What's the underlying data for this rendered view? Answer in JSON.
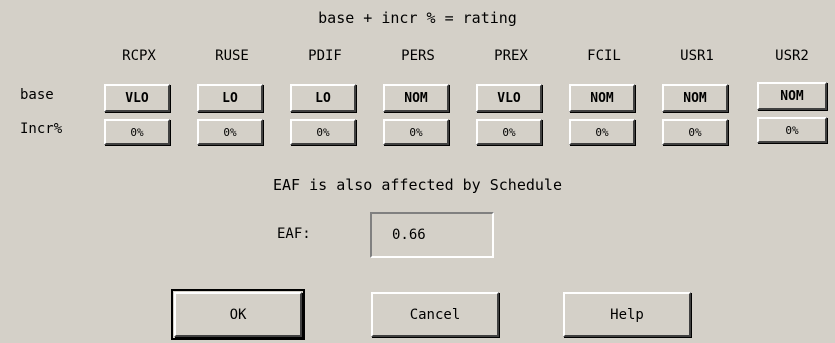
{
  "title": "base + incr % = rating",
  "row_labels": {
    "base": "base",
    "incr": "Incr%"
  },
  "columns": [
    {
      "header": "RCPX",
      "base": "VLO",
      "incr": "0%"
    },
    {
      "header": "RUSE",
      "base": "LO",
      "incr": "0%"
    },
    {
      "header": "PDIF",
      "base": "LO",
      "incr": "0%"
    },
    {
      "header": "PERS",
      "base": "NOM",
      "incr": "0%"
    },
    {
      "header": "PREX",
      "base": "VLO",
      "incr": "0%"
    },
    {
      "header": "FCIL",
      "base": "NOM",
      "incr": "0%"
    },
    {
      "header": "USR1",
      "base": "NOM",
      "incr": "0%"
    },
    {
      "header": "USR2",
      "base": "NOM",
      "incr": "0%"
    }
  ],
  "note": "EAF is also affected by Schedule",
  "eaf": {
    "label": "EAF:",
    "value": "0.66"
  },
  "buttons": {
    "ok": "OK",
    "cancel": "Cancel",
    "help": "Help"
  }
}
